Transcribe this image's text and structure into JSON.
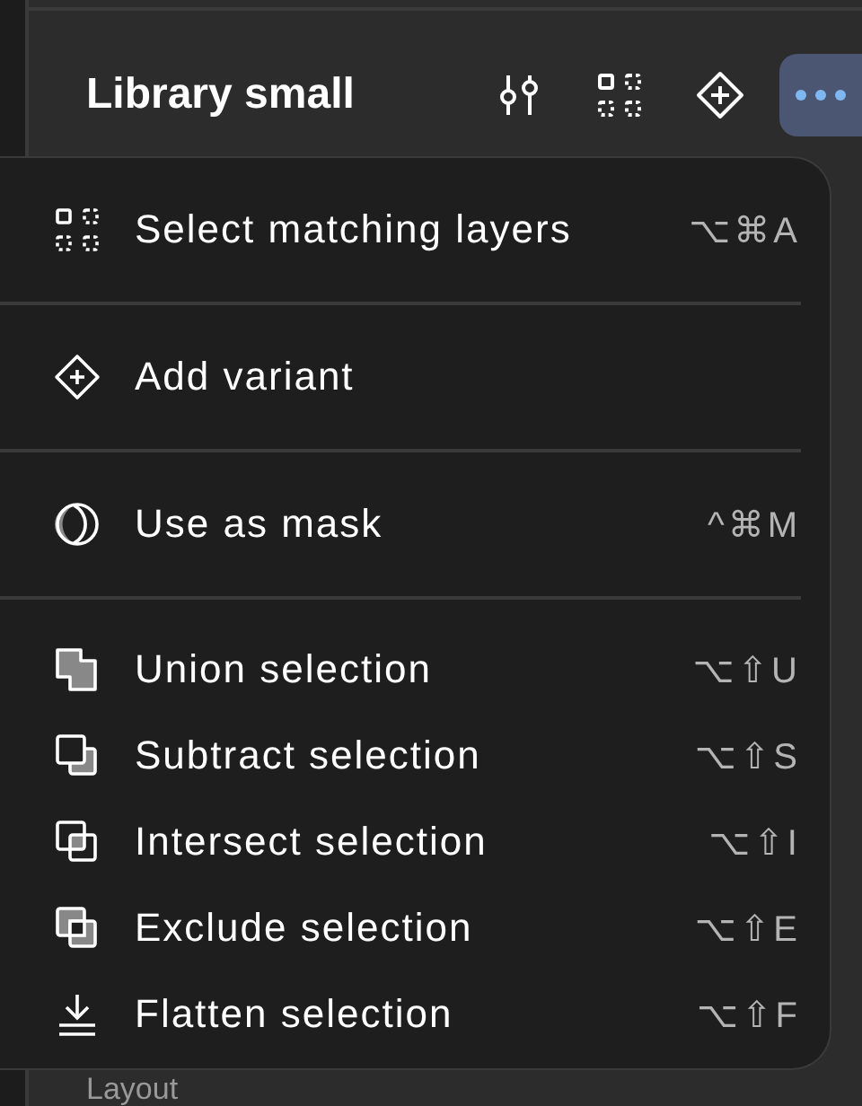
{
  "panel": {
    "title": "Library small",
    "toolbar": [
      {
        "kind": "sliders",
        "selected": false
      },
      {
        "kind": "grid",
        "selected": false
      },
      {
        "kind": "diamond-plus",
        "selected": false
      },
      {
        "kind": "more",
        "selected": true
      }
    ]
  },
  "menu": {
    "groups": [
      [
        {
          "label": "Select matching layers",
          "shortcut": "⌥⌘A"
        }
      ],
      [
        {
          "label": "Add variant"
        }
      ],
      [
        {
          "label": "Use as mask",
          "shortcut": "^⌘M"
        }
      ],
      [
        {
          "label": "Union selection",
          "shortcut": "⌥⇧U"
        },
        {
          "label": "Subtract selection",
          "shortcut": "⌥⇧S"
        },
        {
          "label": "Intersect selection",
          "shortcut": "⌥⇧I"
        },
        {
          "label": "Exclude selection",
          "shortcut": "⌥⇧E"
        },
        {
          "label": "Flatten selection",
          "shortcut": "⌥⇧F"
        }
      ]
    ]
  },
  "below": {
    "section_label": "Layout"
  }
}
